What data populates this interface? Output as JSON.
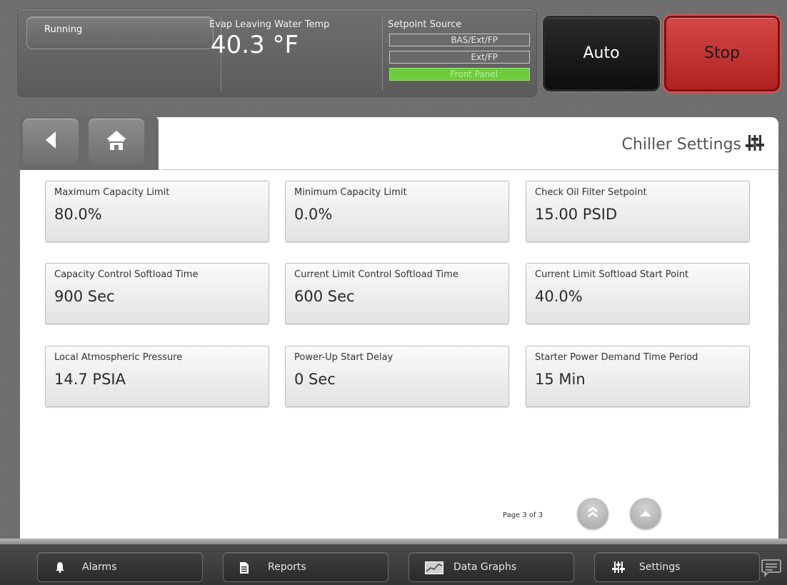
{
  "status": {
    "operating_mode": "Running",
    "evap_label": "Evap Leaving Water Temp",
    "evap_value": "40.3 °F",
    "setpoint_source_label": "Setpoint Source",
    "setpoint_options": [
      "BAS/Ext/FP",
      "Ext/FP",
      "Front Panel"
    ],
    "active_setpoint_option": "Front Panel"
  },
  "controls": {
    "auto_label": "Auto",
    "stop_label": "Stop"
  },
  "page": {
    "title": "Chiller Settings",
    "indicator": "Page 3 of 3"
  },
  "settings": [
    {
      "label": "Maximum Capacity Limit",
      "value": "80.0%"
    },
    {
      "label": "Minimum Capacity Limit",
      "value": "0.0%"
    },
    {
      "label": "Check Oil Filter Setpoint",
      "value": "15.00 PSID"
    },
    {
      "label": "Capacity Control Softload Time",
      "value": "900 Sec"
    },
    {
      "label": "Current Limit Control Softload Time",
      "value": "600 Sec"
    },
    {
      "label": "Current Limit Softload Start Point",
      "value": "40.0%"
    },
    {
      "label": "Local Atmospheric Pressure",
      "value": "14.7 PSIA"
    },
    {
      "label": "Power-Up Start Delay",
      "value": "0 Sec"
    },
    {
      "label": "Starter Power Demand Time Period",
      "value": "15 Min"
    }
  ],
  "footer": {
    "alarms": "Alarms",
    "reports": "Reports",
    "data_graphs": "Data Graphs",
    "settings": "Settings"
  },
  "icons": {
    "back": "back-arrow-icon",
    "home": "home-icon",
    "settings": "sliders-icon",
    "page_top": "double-chevron-up-icon",
    "page_up": "chevron-up-icon",
    "alarm": "bell-icon",
    "reports": "document-icon",
    "graphs": "chart-icon",
    "chat": "chat-bubble-icon"
  },
  "colors": {
    "stop": "#c03030",
    "active_source": "#6ecb3c",
    "panel": "#ffffff"
  }
}
